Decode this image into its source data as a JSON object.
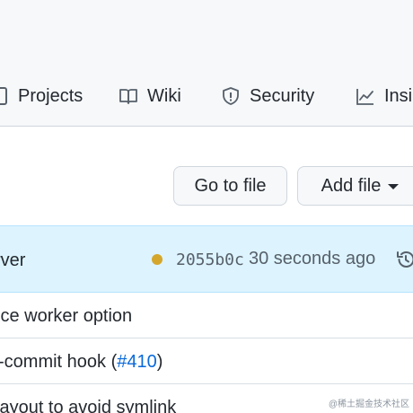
{
  "nav": {
    "items": [
      {
        "label": "Projects",
        "icon": "project-board-icon"
      },
      {
        "label": "Wiki",
        "icon": "book-icon"
      },
      {
        "label": "Security",
        "icon": "shield-icon"
      },
      {
        "label": "Insi",
        "icon": "graph-icon"
      }
    ]
  },
  "toolbar": {
    "go_to_file": "Go to file",
    "add_file": "Add file"
  },
  "latest_commit": {
    "message": "rver",
    "status_color": "#d4a72c",
    "sha": "2055b0c",
    "time_ago": "30 seconds ago"
  },
  "rows": [
    {
      "text": "ice worker option"
    },
    {
      "text_before": "-commit hook (",
      "link": "#410",
      "text_after": ")"
    },
    {
      "text": "layout to avoid symlink"
    }
  ],
  "watermark": "@稀土掘金技术社区",
  "colors": {
    "link": "#0969da",
    "commit_bar_bg": "#ddf4ff",
    "header_bg": "#f6f8fa"
  }
}
